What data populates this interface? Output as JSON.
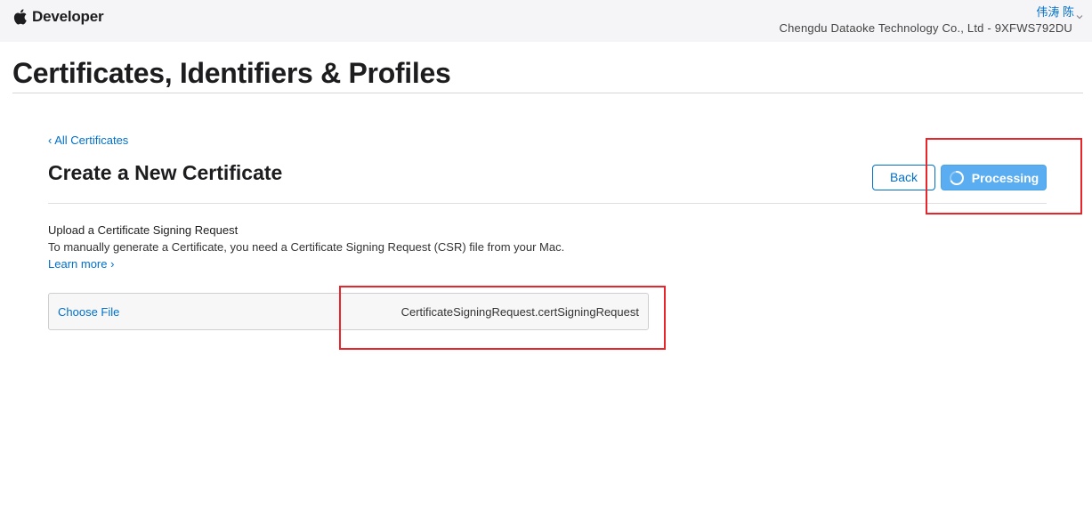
{
  "header": {
    "brand_label": "Developer",
    "user_name": "伟涛 陈",
    "team_name": "Chengdu Dataoke Technology Co., Ltd - 9XFWS792DU"
  },
  "page": {
    "title": "Certificates, Identifiers & Profiles"
  },
  "certificate": {
    "back_link": "‹ All Certificates",
    "title": "Create a New Certificate",
    "back_button": "Back",
    "processing_button": "Processing",
    "upload_heading": "Upload a Certificate Signing Request",
    "upload_desc": "To manually generate a Certificate, you need a Certificate Signing Request (CSR) file from your Mac.",
    "learn_more": "Learn more ›",
    "choose_file": "Choose File",
    "file_name": "CertificateSigningRequest.certSigningRequest"
  },
  "colors": {
    "accent": "#0070c9",
    "processing_bg": "#59adf0",
    "highlight": "#e8252a"
  },
  "icons": [
    "apple-icon",
    "chevron-down-icon",
    "spinner-icon"
  ]
}
